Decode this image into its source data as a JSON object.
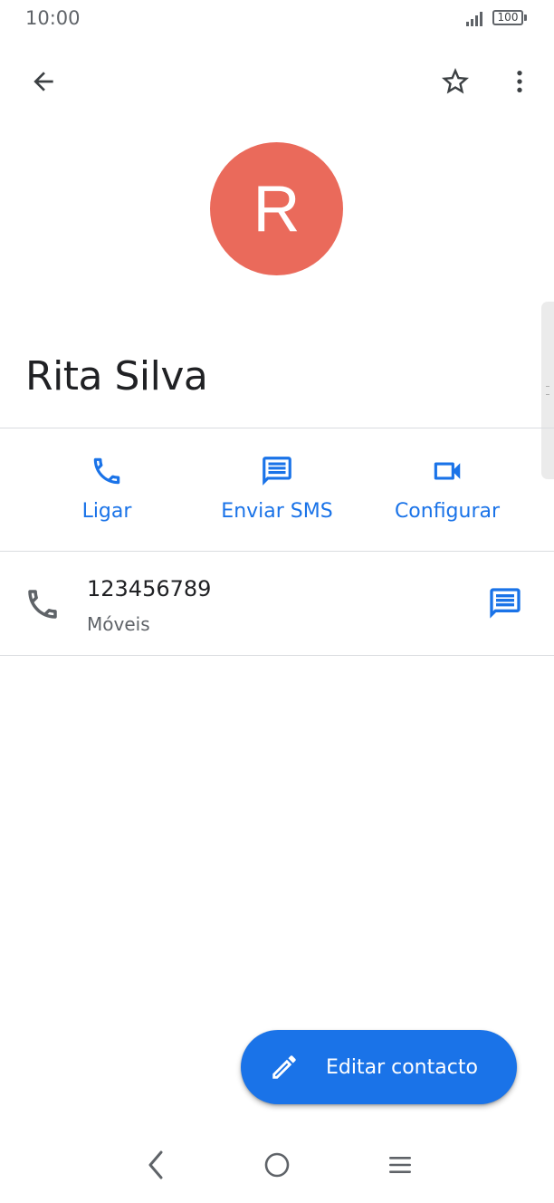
{
  "status_bar": {
    "time": "10:00",
    "battery": "100",
    "icons": [
      "signal-icon",
      "battery-icon"
    ]
  },
  "app_bar": {
    "icons": [
      "back-arrow-icon",
      "star-outline-icon",
      "more-vert-icon"
    ]
  },
  "contact": {
    "avatar_letter": "R",
    "avatar_color": "#ea6a5b",
    "name": "Rita Silva"
  },
  "actions": [
    {
      "label": "Ligar",
      "icon": "phone-icon"
    },
    {
      "label": "Enviar SMS",
      "icon": "message-icon"
    },
    {
      "label": "Configurar",
      "icon": "video-icon"
    }
  ],
  "phone": {
    "number": "123456789",
    "type": "Móveis",
    "icon": "phone-icon",
    "action_icon": "message-icon"
  },
  "fab": {
    "label": "Editar contacto",
    "icon": "pencil-icon"
  },
  "nav_bar": {
    "icons": [
      "nav-back-icon",
      "nav-home-icon",
      "nav-recents-icon"
    ]
  },
  "colors": {
    "accent": "#1a73e8",
    "avatar": "#ea6a5b",
    "text_primary": "#202124",
    "text_secondary": "#5f6368"
  }
}
